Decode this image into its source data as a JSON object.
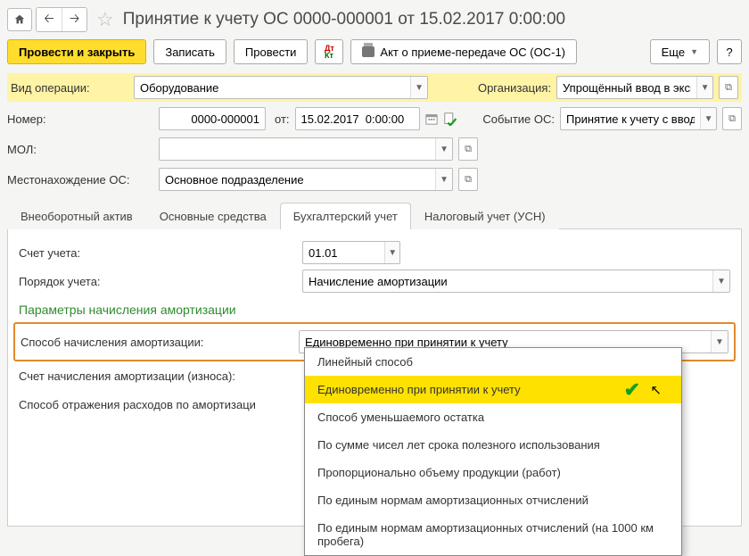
{
  "title": "Принятие к учету ОС 0000-000001 от 15.02.2017 0:00:00",
  "cmd": {
    "post_close": "Провести и закрыть",
    "save": "Записать",
    "post": "Провести",
    "print_act": "Акт о приеме-передаче ОС (ОС-1)",
    "more": "Еще",
    "help": "?"
  },
  "labels": {
    "op_type": "Вид операции:",
    "number": "Номер:",
    "from": "от:",
    "org": "Организация:",
    "event": "Событие ОС:",
    "mol": "МОЛ:",
    "loc": "Местонахождение ОС:"
  },
  "values": {
    "op_type": "Оборудование",
    "number": "0000-000001",
    "date": "15.02.2017  0:00:00",
    "org": "Упрощённый ввод в экспл. С",
    "event": "Принятие к учету с вводом в",
    "mol": "",
    "loc": "Основное подразделение"
  },
  "tabs": {
    "t1": "Внеоборотный актив",
    "t2": "Основные средства",
    "t3": "Бухгалтерский учет",
    "t4": "Налоговый учет (УСН)"
  },
  "acc": {
    "account_lbl": "Счет учета:",
    "account_val": "01.01",
    "order_lbl": "Порядок учета:",
    "order_val": "Начисление амортизации",
    "section": "Параметры начисления амортизации",
    "method_lbl": "Способ начисления амортизации:",
    "method_val": "Единовременно при принятии к учету",
    "depr_acc_lbl": "Счет начисления амортизации (износа):",
    "expense_lbl": "Способ отражения расходов по амортизаци"
  },
  "dd": {
    "o1": "Линейный способ",
    "o2": "Единовременно при принятии к учету",
    "o3": "Способ уменьшаемого остатка",
    "o4": "По сумме чисел лет срока полезного использования",
    "o5": "Пропорционально объему продукции (работ)",
    "o6": "По единым нормам амортизационных отчислений",
    "o7": "По единым нормам амортизационных отчислений (на 1000 км пробега)"
  }
}
